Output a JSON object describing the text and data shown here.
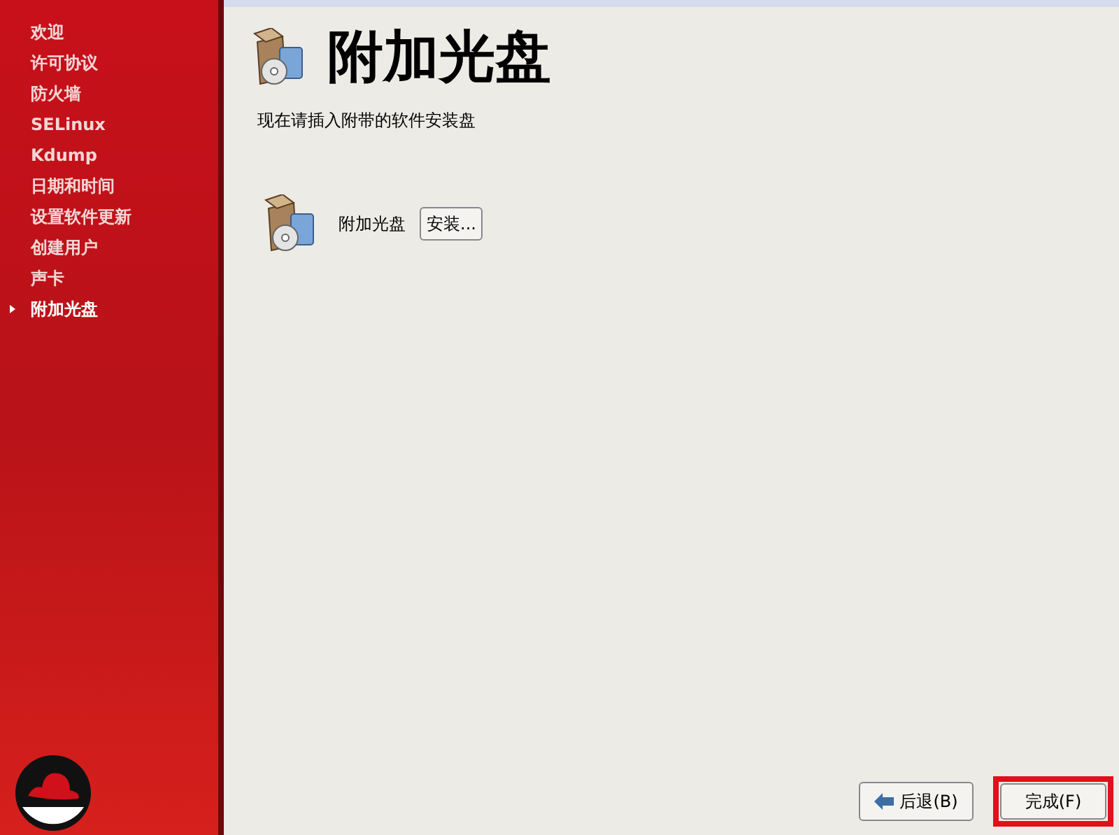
{
  "sidebar": {
    "items": [
      {
        "label": "欢迎",
        "selected": false
      },
      {
        "label": "许可协议",
        "selected": false
      },
      {
        "label": "防火墙",
        "selected": false
      },
      {
        "label": "SELinux",
        "selected": false
      },
      {
        "label": "Kdump",
        "selected": false
      },
      {
        "label": "日期和时间",
        "selected": false
      },
      {
        "label": "设置软件更新",
        "selected": false
      },
      {
        "label": "创建用户",
        "selected": false
      },
      {
        "label": "声卡",
        "selected": false
      },
      {
        "label": "附加光盘",
        "selected": true
      }
    ]
  },
  "page": {
    "title": "附加光盘",
    "subtitle": "现在请插入附带的软件安装盘",
    "disc": {
      "label": "附加光盘",
      "button": "安装..."
    }
  },
  "buttons": {
    "back": "后退(B)",
    "finish": "完成(F)"
  }
}
